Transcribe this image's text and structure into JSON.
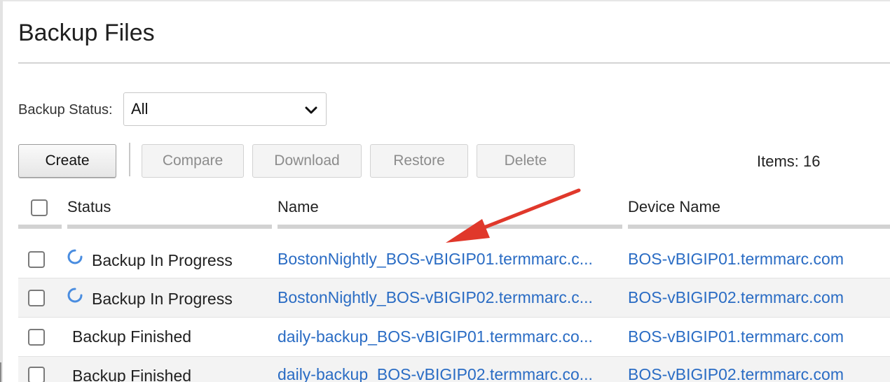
{
  "page": {
    "title": "Backup Files"
  },
  "filter": {
    "label": "Backup Status:",
    "selected": "All"
  },
  "toolbar": {
    "create_label": "Create",
    "compare_label": "Compare",
    "download_label": "Download",
    "restore_label": "Restore",
    "delete_label": "Delete",
    "items_count": "Items: 16"
  },
  "table": {
    "columns": [
      "Status",
      "Name",
      "Device Name"
    ],
    "rows": [
      {
        "status": "Backup In Progress",
        "in_progress": true,
        "name": "BostonNightly_BOS-vBIGIP01.termmarc.c...",
        "device": "BOS-vBIGIP01.termmarc.com"
      },
      {
        "status": "Backup In Progress",
        "in_progress": true,
        "name": "BostonNightly_BOS-vBIGIP02.termmarc.c...",
        "device": "BOS-vBIGIP02.termmarc.com"
      },
      {
        "status": "Backup Finished",
        "in_progress": false,
        "name": "daily-backup_BOS-vBIGIP01.termmarc.co...",
        "device": "BOS-vBIGIP01.termmarc.com"
      },
      {
        "status": "Backup Finished",
        "in_progress": false,
        "name": "daily-backup_BOS-vBIGIP02.termmarc.co...",
        "device": "BOS-vBIGIP02.termmarc.com"
      }
    ]
  },
  "icons": {
    "select_chevron": "chevron-down-icon",
    "progress": "spinner-icon",
    "annotation": "arrow-annotation-icon"
  },
  "colors": {
    "link": "#2a6cc4",
    "annotation_arrow": "#e0382b",
    "alt_row": "#f3f3f3"
  }
}
